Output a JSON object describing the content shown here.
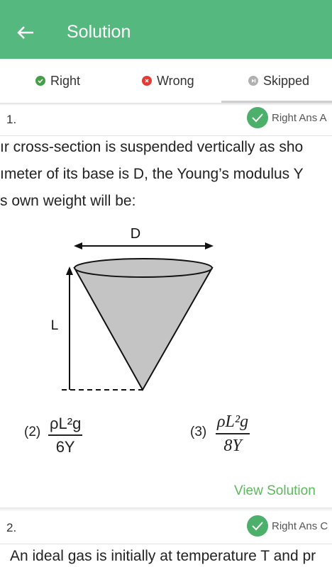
{
  "header": {
    "title": "Solution",
    "back_icon": "arrow-left-icon"
  },
  "tabs": [
    {
      "label": "Right",
      "icon": "check-dot-icon",
      "color": "#43a047"
    },
    {
      "label": "Wrong",
      "icon": "x-dot-icon",
      "color": "#e53935"
    },
    {
      "label": "Skipped",
      "icon": "skip-dot-icon",
      "color": "#9e9e9e",
      "selected": true
    }
  ],
  "questions": [
    {
      "number": "1.",
      "badge": "Right Ans  A",
      "lines": [
        "ır cross-section is suspended vertically as sho",
        "ımeter of its base is D, the Young’s modulus Y",
        "s own weight will be:"
      ],
      "figure": {
        "label_d": "D",
        "label_l": "L"
      },
      "options": [
        {
          "label": "(2)",
          "numerator": "ρL²g",
          "denominator": "6Y"
        },
        {
          "label": "(3)",
          "numerator": "ρL²g",
          "denominator": "8Y"
        }
      ],
      "view_solution": "View Solution"
    },
    {
      "number": "2.",
      "badge": "Right Ans  C",
      "lines": [
        "An ideal gas is initially at temperature T and pr"
      ]
    }
  ],
  "colors": {
    "primary": "#55b97f",
    "accent_green": "#5cb85c"
  }
}
